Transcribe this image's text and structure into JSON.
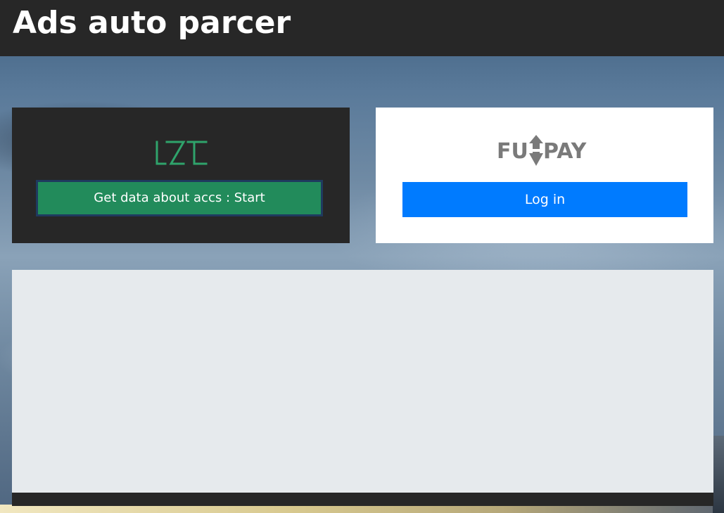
{
  "header": {
    "title": "Ads auto parcer"
  },
  "lzt_card": {
    "logo_icon": "lzt-logo",
    "logo_color": "#2fa36b",
    "start_button_label": "Get data about accs : Start",
    "button_color": "#228b5b"
  },
  "funpay_card": {
    "logo_icon": "funpay-logo",
    "logo_text_left": "FU",
    "logo_text_right": "PAY",
    "logo_color": "#7a7a7a",
    "login_button_label": "Log in",
    "button_color": "#007bff"
  },
  "output": {
    "content": ""
  }
}
